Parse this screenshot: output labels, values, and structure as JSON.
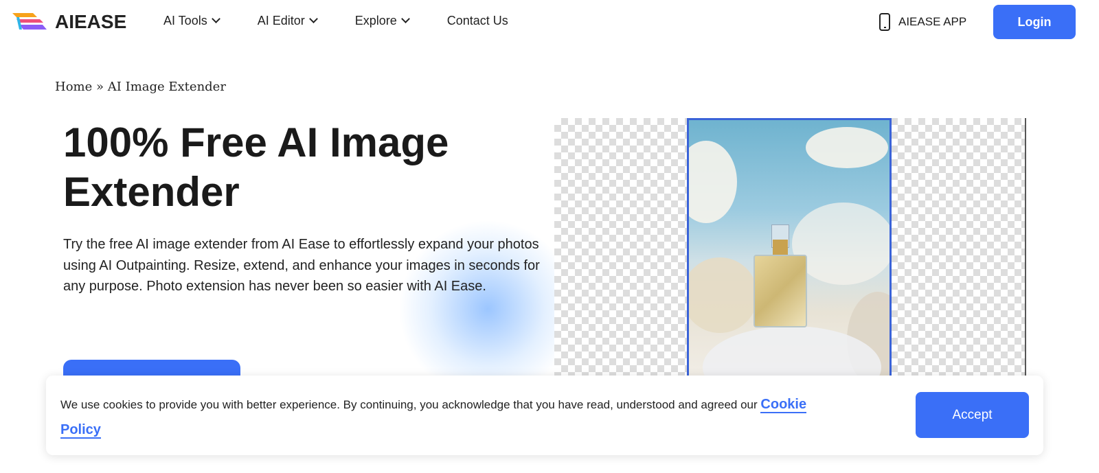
{
  "nav": {
    "brand": "AIEASE",
    "items": [
      {
        "label": "AI Tools",
        "has_dropdown": true
      },
      {
        "label": "AI Editor",
        "has_dropdown": true
      },
      {
        "label": "Explore",
        "has_dropdown": true
      },
      {
        "label": "Contact Us",
        "has_dropdown": false
      }
    ],
    "app_label": "AIEASE APP",
    "login_label": "Login"
  },
  "breadcrumb": {
    "home": "Home",
    "separator": "»",
    "current": "AI Image Extender"
  },
  "hero": {
    "title": "100% Free AI Image Extender",
    "description": "Try the free AI image extender from AI Ease to effortlessly expand your photos using AI Outpainting. Resize, extend, and enhance your images in seconds for any purpose. Photo extension has never been so easier with AI Ease."
  },
  "cookie": {
    "text": "We use cookies to provide you with better experience. By continuing, you acknowledge that you have read, understood and agreed our",
    "link": "Cookie Policy",
    "accept_label": "Accept"
  },
  "colors": {
    "accent": "#3a6ff7"
  }
}
